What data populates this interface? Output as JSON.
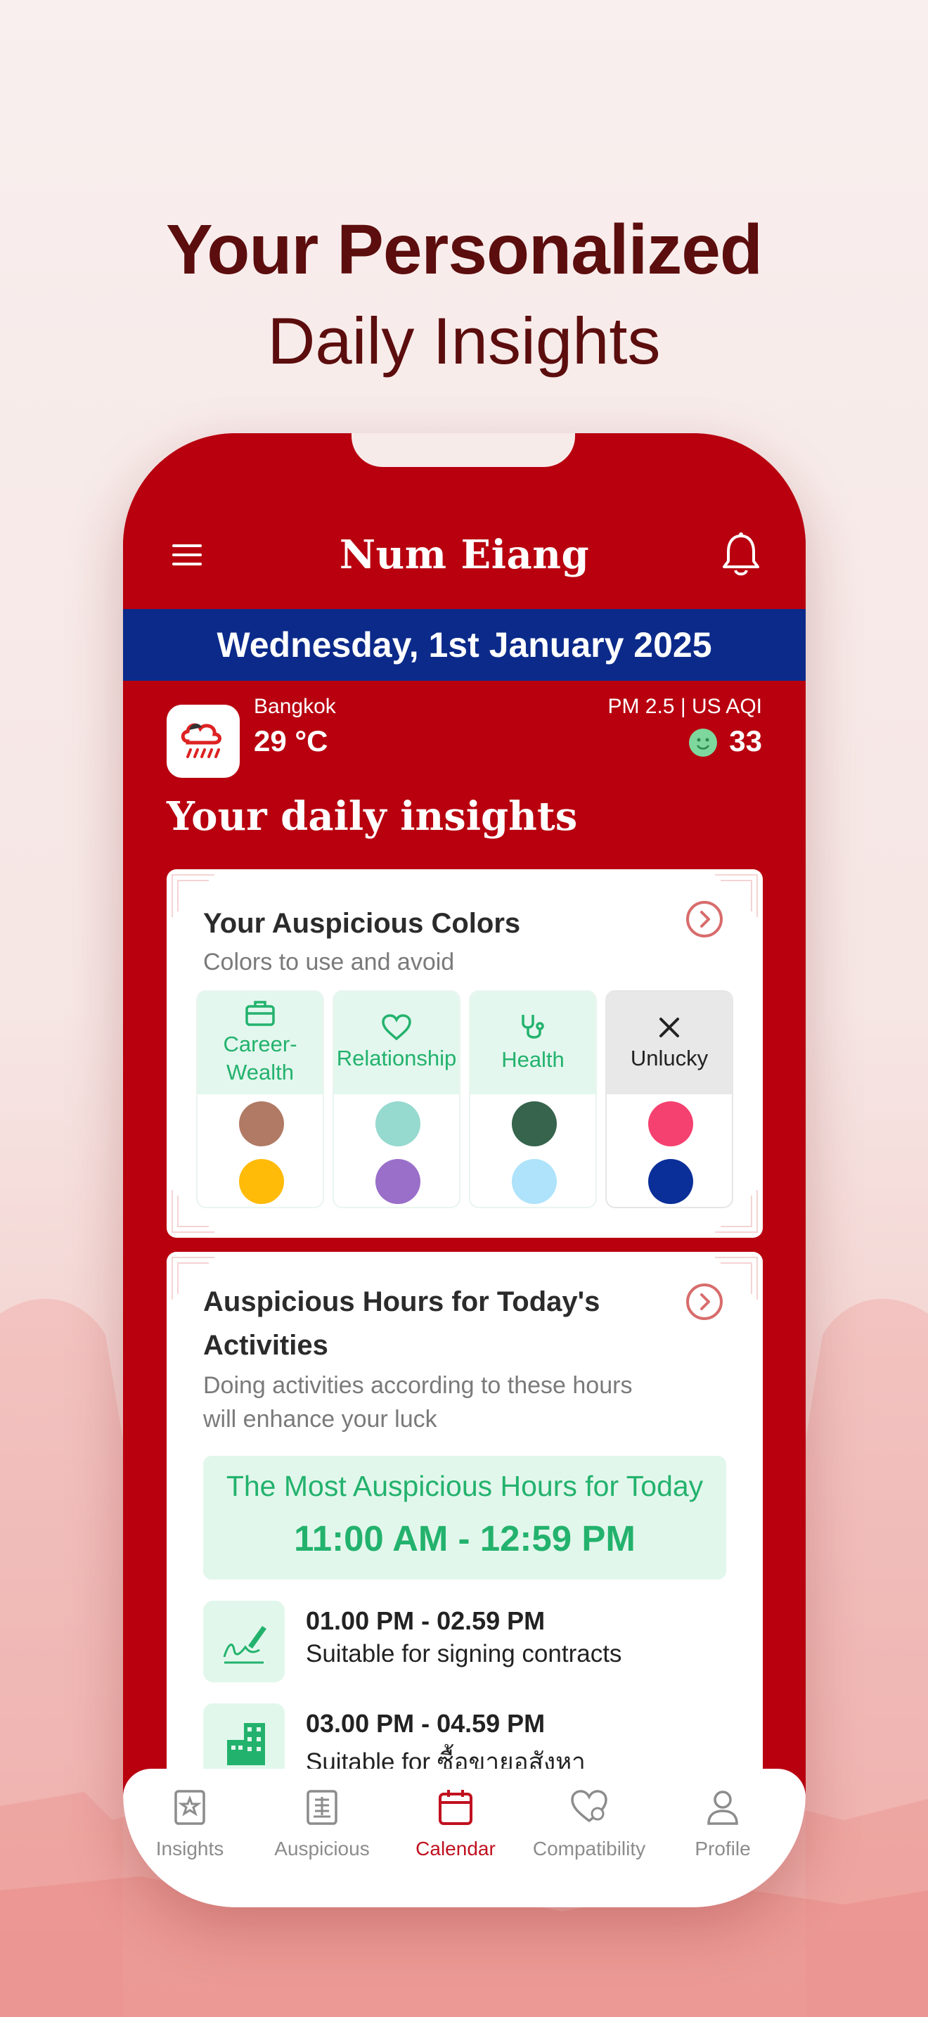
{
  "headline": {
    "line1": "Your Personalized",
    "line2": "Daily Insights"
  },
  "app": {
    "title": "Num Eiang",
    "date": "Wednesday, 1st January 2025"
  },
  "weather": {
    "city": "Bangkok",
    "temperature": "29 °C",
    "aqi_label": "PM 2.5 | US AQI",
    "aqi_value": "33"
  },
  "insights": {
    "section_title": "Your daily insights",
    "colors_card": {
      "title": "Your Auspicious Colors",
      "subtitle": "Colors to use and avoid",
      "categories": [
        {
          "label": "Career-\nWealth",
          "icon": "briefcase-icon",
          "colors": [
            "#b07a64",
            "#ffbb08"
          ]
        },
        {
          "label": "Relationship",
          "icon": "heart-icon",
          "colors": [
            "#96d9cf",
            "#9a6fc9"
          ]
        },
        {
          "label": "Health",
          "icon": "stethoscope-icon",
          "colors": [
            "#36644d",
            "#aee3fb"
          ]
        },
        {
          "label": "Unlucky",
          "icon": "close-icon",
          "colors": [
            "#f5416f",
            "#0a2f99"
          ]
        }
      ]
    },
    "hours_card": {
      "title_line1": "Auspicious Hours for Today's",
      "title_line2": "Activities",
      "subtitle_line1": "Doing activities according to these hours",
      "subtitle_line2": "will enhance your luck",
      "best_label": "The Most Auspicious Hours for Today",
      "best_time": "11:00 AM - 12:59 PM",
      "rows": [
        {
          "time": "01.00 PM - 02.59 PM",
          "desc": "Suitable for signing contracts",
          "icon": "signature-icon"
        },
        {
          "time": "03.00 PM - 04.59 PM",
          "desc": "Suitable for ซื้อขายอสังหา",
          "icon": "buildings-icon"
        }
      ]
    }
  },
  "tabs": [
    {
      "label": "Insights",
      "icon": "insights-icon",
      "active": false
    },
    {
      "label": "Auspicious",
      "icon": "auspicious-icon",
      "active": false
    },
    {
      "label": "Calendar",
      "icon": "calendar-icon",
      "active": true
    },
    {
      "label": "Compatibility",
      "icon": "compatibility-icon",
      "active": false
    },
    {
      "label": "Profile",
      "icon": "profile-icon",
      "active": false
    }
  ],
  "colors": {
    "primary_red": "#b8000f",
    "date_blue": "#0b2a8a",
    "accent_green": "#23b26d",
    "headline": "#5c0d0d"
  }
}
